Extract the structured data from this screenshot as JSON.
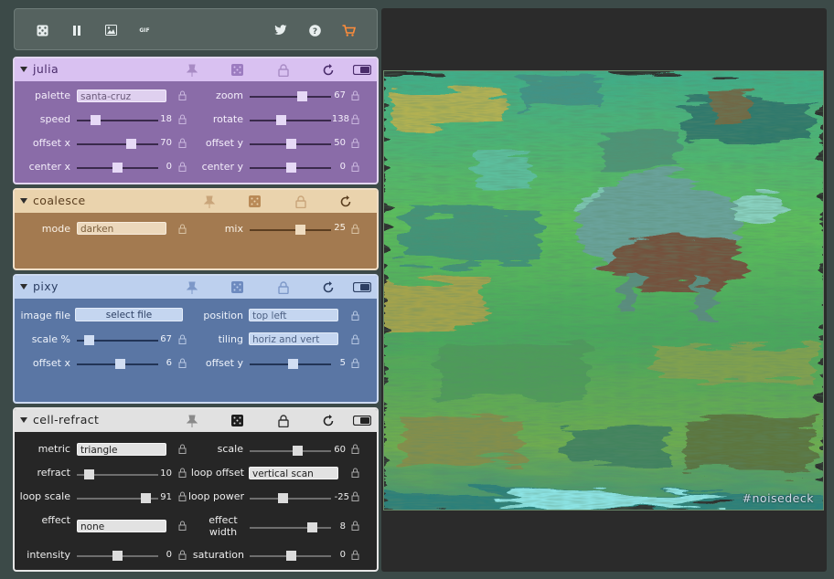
{
  "toolbar": {
    "buttons": [
      {
        "icon": "dice-icon"
      },
      {
        "icon": "pause-icon"
      },
      {
        "icon": "image-icon"
      },
      {
        "icon": "gif-icon",
        "label": "GIF"
      },
      {
        "icon": "twitter-icon"
      },
      {
        "icon": "help-icon"
      },
      {
        "icon": "cart-icon"
      }
    ]
  },
  "panels": {
    "julia": {
      "title": "julia",
      "color": "#8a6ca8",
      "controls": {
        "palette": {
          "label": "palette",
          "value": "santa-cruz"
        },
        "zoom": {
          "label": "zoom",
          "value": "67",
          "level": 0.64
        },
        "speed": {
          "label": "speed",
          "value": "18",
          "level": 0.22
        },
        "rotate": {
          "label": "rotate",
          "value": "138",
          "level": 0.38
        },
        "offset_x": {
          "label": "offset x",
          "value": "70",
          "level": 0.66
        },
        "offset_y": {
          "label": "offset y",
          "value": "50",
          "level": 0.5
        },
        "center_x": {
          "label": "center x",
          "value": "0",
          "level": 0.49
        },
        "center_y": {
          "label": "center y",
          "value": "0",
          "level": 0.5
        }
      }
    },
    "coalesce": {
      "title": "coalesce",
      "color": "#a37a50",
      "controls": {
        "mode": {
          "label": "mode",
          "value": "darken"
        },
        "mix": {
          "label": "mix",
          "value": "25",
          "level": 0.62
        }
      }
    },
    "pixy": {
      "title": "pixy",
      "color": "#5a76a4",
      "controls": {
        "image_file": {
          "label": "image file",
          "button": "select file"
        },
        "position": {
          "label": "position",
          "value": "top left"
        },
        "scale": {
          "label": "scale %",
          "value": "67",
          "level": 0.15
        },
        "tiling": {
          "label": "tiling",
          "value": "horiz and vert"
        },
        "offset_x": {
          "label": "offset x",
          "value": "6",
          "level": 0.53
        },
        "offset_y": {
          "label": "offset y",
          "value": "5",
          "level": 0.53
        }
      }
    },
    "cell_refract": {
      "title": "cell-refract",
      "color": "#262626",
      "controls": {
        "metric": {
          "label": "metric",
          "value": "triangle"
        },
        "scale": {
          "label": "scale",
          "value": "60",
          "level": 0.58
        },
        "refract": {
          "label": "refract",
          "value": "10",
          "level": 0.15
        },
        "loop_offset": {
          "label": "loop offset",
          "value": "vertical scan"
        },
        "loop_scale": {
          "label": "loop scale",
          "value": "91",
          "level": 0.84
        },
        "loop_power": {
          "label": "loop power",
          "value": "-25",
          "level": 0.4
        },
        "effect": {
          "label": "effect",
          "value": "none"
        },
        "effect_width": {
          "label": "effect width",
          "value": "8",
          "level": 0.76
        },
        "intensity": {
          "label": "intensity",
          "value": "0",
          "level": 0.49
        },
        "saturation": {
          "label": "saturation",
          "value": "0",
          "level": 0.51
        }
      }
    }
  },
  "canvas": {
    "watermark": "#noisedeck"
  }
}
